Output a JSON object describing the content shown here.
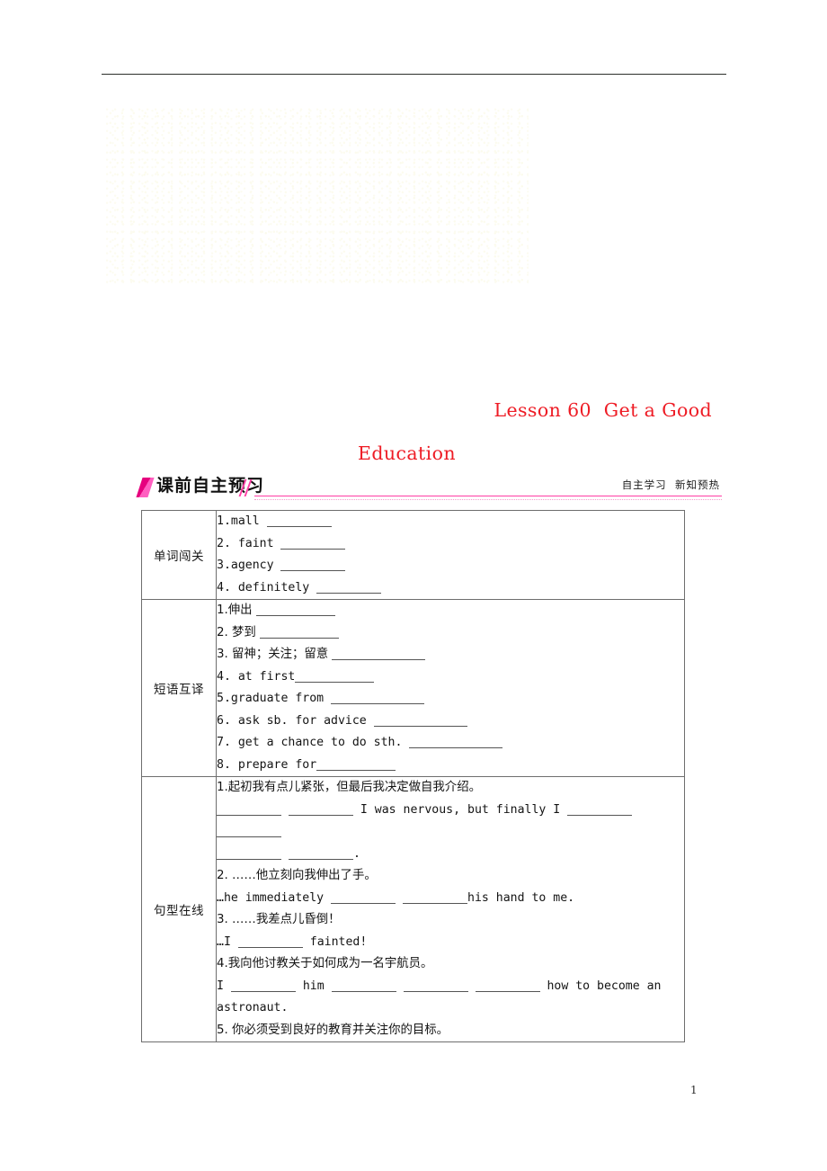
{
  "document": {
    "page_number": "1",
    "title_line_1": "Lesson 60  Get a Good",
    "title_line_2": "Education",
    "title_color": "#ee1c25"
  },
  "banner": {
    "title": "课前自主预习",
    "subtitle": "自主学习  新知预热",
    "accent_color": "#ff3ea5",
    "slash_color": "#e6007e"
  },
  "table": {
    "rows": [
      {
        "label": "单词闯关",
        "lines": [
          "1.mall ",
          "2. faint ",
          "3.agency ",
          "4. definitely "
        ]
      },
      {
        "label": "短语互译",
        "lines": [
          "1.伸出 ",
          "2. 梦到 ",
          "3. 留神；关注；留意 ",
          "4. at first",
          "5.graduate from ",
          "6. ask sb. for advice ",
          "7. get a chance to do sth. ",
          "8. prepare for"
        ]
      },
      {
        "label": "句型在线",
        "lines": [
          "1.起初我有点儿紧张，但最后我决定做自我介绍。",
          "I was nervous, but finally I",
          ".",
          "2. ……他立刻向我伸出了手。",
          "…he immediately ",
          "his hand to me.",
          "3. ……我差点儿昏倒！",
          "…I ",
          " fainted!",
          "4.我向他讨教关于如何成为一名宇航员。",
          "I ",
          "him ",
          "how to become an",
          "astronaut.",
          "5. 你必须受到良好的教育并关注你的目标。"
        ]
      }
    ]
  }
}
